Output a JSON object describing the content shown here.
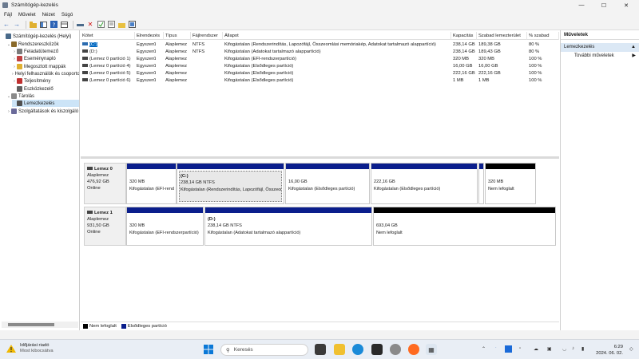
{
  "window": {
    "title": "Számítógép-kezelés",
    "controls": [
      "—",
      "☐",
      "✕"
    ]
  },
  "menu": [
    "Fájl",
    "Művelet",
    "Nézet",
    "Súgó"
  ],
  "tree": {
    "items": [
      {
        "label": "Számítógép-kezelés (Helyi)",
        "level": 0,
        "chev": "",
        "icon": "computer-management-icon",
        "color": "#4a6a8a"
      },
      {
        "label": "Rendszereszközök",
        "level": 1,
        "chev": "v",
        "icon": "tools-icon",
        "color": "#8a6a2a"
      },
      {
        "label": "Feladatütemező",
        "level": 2,
        "chev": ">",
        "icon": "clock-icon",
        "color": "#7a7a7a"
      },
      {
        "label": "Eseménynapló",
        "level": 2,
        "chev": ">",
        "icon": "event-viewer-icon",
        "color": "#c04040"
      },
      {
        "label": "Megosztott mappák",
        "level": 2,
        "chev": ">",
        "icon": "folder-icon",
        "color": "#e0b030"
      },
      {
        "label": "Helyi felhasználók és csoportok",
        "level": 2,
        "chev": ">",
        "icon": "users-icon",
        "color": "#4070c0"
      },
      {
        "label": "Teljesítmény",
        "level": 2,
        "chev": ">",
        "icon": "performance-icon",
        "color": "#c03030"
      },
      {
        "label": "Eszközkezelő",
        "level": 2,
        "chev": "",
        "icon": "device-manager-icon",
        "color": "#606060"
      },
      {
        "label": "Tárolás",
        "level": 1,
        "chev": "v",
        "icon": "storage-icon",
        "color": "#8a8a8a"
      },
      {
        "label": "Lemezkezelés",
        "level": 2,
        "chev": "",
        "icon": "disk-icon",
        "color": "#505050",
        "selected": true
      },
      {
        "label": "Szolgáltatások és kiszolgáló",
        "level": 1,
        "chev": ">",
        "icon": "services-icon",
        "color": "#6a6a9a"
      }
    ]
  },
  "volumes": {
    "headers": [
      "Kötet",
      "Elrendezés",
      "Típus",
      "Fájlrendszer",
      "Állapot",
      "Kapacitás",
      "Szabad lemezterület",
      "% szabad"
    ],
    "rows": [
      [
        "(C:)",
        "Egyszerű",
        "Alaplemez",
        "NTFS",
        "Kifogástalan (Rendszerindítás, Lapozófájl, Összeomlási memóriakép, Adatokat tartalmazó alappartíció)",
        "238,14 GB",
        "189,38 GB",
        "80 %"
      ],
      [
        "(D:)",
        "Egyszerű",
        "Alaplemez",
        "NTFS",
        "Kifogástalan (Adatokat tartalmazó alappartíció)",
        "238,14 GB",
        "189,43 GB",
        "80 %"
      ],
      [
        "(Lemez 0 partíció 1)",
        "Egyszerű",
        "Alaplemez",
        "",
        "Kifogástalan (EFI-rendszerpartíció)",
        "320 MB",
        "320 MB",
        "100 %"
      ],
      [
        "(Lemez 0 partíció 4)",
        "Egyszerű",
        "Alaplemez",
        "",
        "Kifogástalan (Elsődleges partíció)",
        "16,00 GB",
        "16,00 GB",
        "100 %"
      ],
      [
        "(Lemez 0 partíció 5)",
        "Egyszerű",
        "Alaplemez",
        "",
        "Kifogástalan (Elsődleges partíció)",
        "222,16 GB",
        "222,16 GB",
        "100 %"
      ],
      [
        "(Lemez 0 partíció 6)",
        "Egyszerű",
        "Alaplemez",
        "",
        "Kifogástalan (Elsődleges partíció)",
        "1 MB",
        "1 MB",
        "100 %"
      ]
    ]
  },
  "disks": [
    {
      "name": "Lemez 0",
      "type": "Alaplemez",
      "size": "476,92 GB",
      "status": "Online",
      "partitions": [
        {
          "title": "",
          "size": "320 MB",
          "status": "Kifogástalan (EFI-rendszerpartíció)",
          "kind": "primary"
        },
        {
          "title": "(C:)",
          "size": "238,14 GB NTFS",
          "status": "Kifogástalan (Rendszerindítás, Lapozófájl, Összeomlási memóriakép, Adatokat tartalmazó alappartíció)",
          "kind": "primary",
          "selected": true
        },
        {
          "title": "",
          "size": "16,00 GB",
          "status": "Kifogástalan (Elsődleges partíció)",
          "kind": "primary"
        },
        {
          "title": "",
          "size": "222,16 GB",
          "status": "Kifogástalan (Elsődleges partíció)",
          "kind": "primary"
        },
        {
          "title": "",
          "size": "",
          "status": "",
          "kind": "primary"
        },
        {
          "title": "",
          "size": "320 MB",
          "status": "Nem lefoglalt",
          "kind": "unallocated"
        }
      ]
    },
    {
      "name": "Lemez 1",
      "type": "Alaplemez",
      "size": "931,50 GB",
      "status": "Online",
      "partitions": [
        {
          "title": "",
          "size": "320 MB",
          "status": "Kifogástalan (EFI-rendszerpartíció)",
          "kind": "primary"
        },
        {
          "title": "(D:)",
          "size": "238,14 GB NTFS",
          "status": "Kifogástalan (Adatokat tartalmazó alappartíció)",
          "kind": "primary"
        },
        {
          "title": "",
          "size": "693,04 GB",
          "status": "Nem lefoglalt",
          "kind": "unallocated"
        }
      ]
    }
  ],
  "legend": [
    {
      "label": "Nem lefoglalt",
      "color": "#000000"
    },
    {
      "label": "Elsődleges partíció",
      "color": "#0a1e8c"
    }
  ],
  "actions": {
    "header": "Műveletek",
    "section": "Lemezkezelés",
    "items": [
      "További műveletek"
    ]
  },
  "taskbar": {
    "weather_title": "Időjárási riadó",
    "weather_sub": "Most kibocsátva",
    "search_placeholder": "Keresés",
    "time": "6:29",
    "date": "2024. 06. 02."
  },
  "colors": {
    "primary_partition": "#0a1e8c",
    "unallocated": "#000000",
    "selection": "#cce4f7",
    "accent": "#0067c0"
  }
}
